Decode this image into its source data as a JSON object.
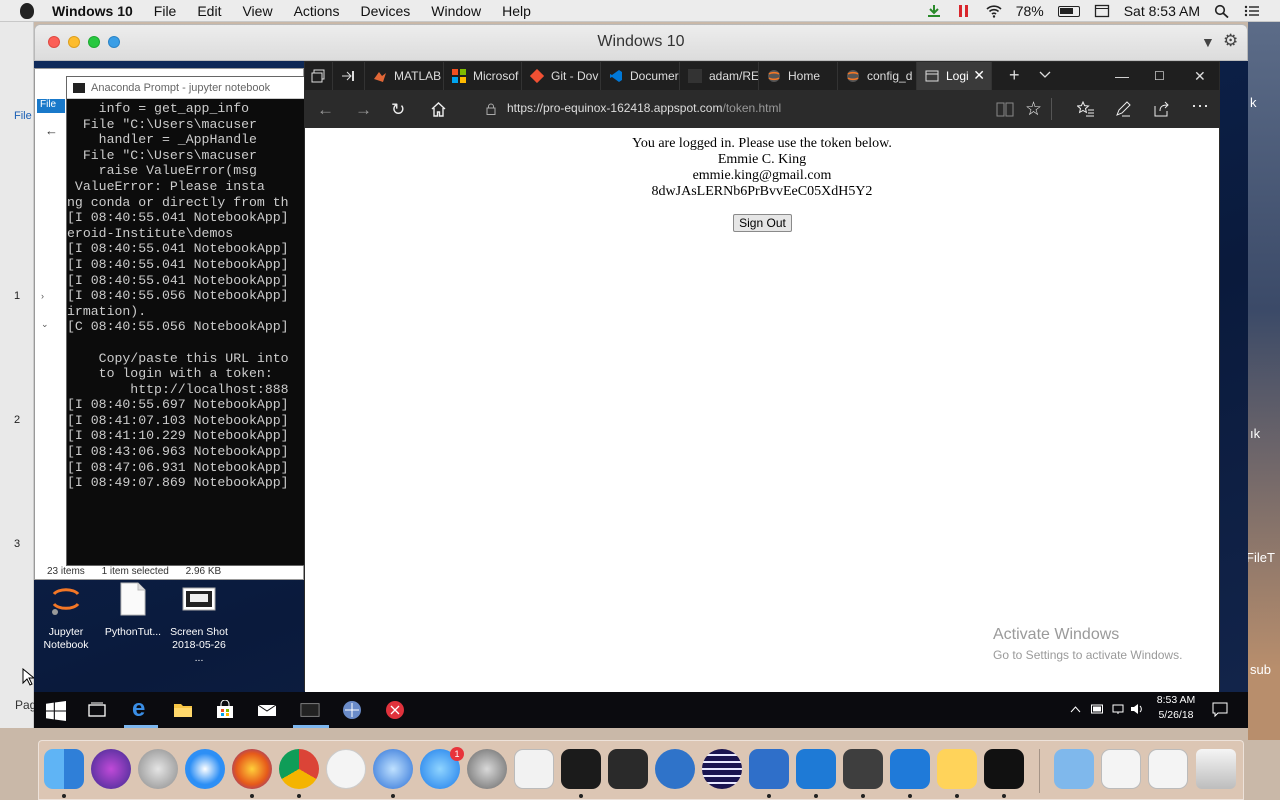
{
  "mac_menubar": {
    "app_name": "Windows 10",
    "menus": [
      "File",
      "Edit",
      "View",
      "Actions",
      "Devices",
      "Window",
      "Help"
    ],
    "battery": "78%",
    "clock": "Sat 8:53 AM"
  },
  "vm_window": {
    "title": "Windows 10"
  },
  "wallpaper_labels": [
    "k",
    "ık",
    "FileT",
    "sub"
  ],
  "ruler_numbers": [
    "1",
    "2",
    "3"
  ],
  "explorer": {
    "status_count": "23 items",
    "status_selected": "1 item selected",
    "status_size": "2.96 KB",
    "partial_menu": "File",
    "partial_footer": "Pag"
  },
  "anaconda": {
    "title": "Anaconda Prompt - jupyter  notebook",
    "lines": [
      "    info = get_app_info",
      "  File \"C:\\Users\\macuser",
      "    handler = _AppHandle",
      "  File \"C:\\Users\\macuser",
      "    raise ValueError(msg",
      " ValueError: Please insta",
      "ng conda or directly from th",
      "[I 08:40:55.041 NotebookApp]",
      "eroid-Institute\\demos",
      "[I 08:40:55.041 NotebookApp]",
      "[I 08:40:55.041 NotebookApp]",
      "[I 08:40:55.041 NotebookApp]",
      "[I 08:40:55.056 NotebookApp]",
      "irmation).",
      "[C 08:40:55.056 NotebookApp]",
      "",
      "    Copy/paste this URL into",
      "    to login with a token:",
      "        http://localhost:888",
      "[I 08:40:55.697 NotebookApp]",
      "[I 08:41:07.103 NotebookApp]",
      "[I 08:41:10.229 NotebookApp]",
      "[I 08:43:06.963 NotebookApp]",
      "[I 08:47:06.931 NotebookApp]",
      "[I 08:49:07.869 NotebookApp]"
    ]
  },
  "desktop_icons": [
    {
      "label": "Jupyter Notebook"
    },
    {
      "label": "PythonTut..."
    },
    {
      "label": "Screen Shot 2018-05-26 ..."
    }
  ],
  "edge": {
    "tabs": [
      {
        "label": "MATLAB",
        "color": "#e16737"
      },
      {
        "label": "Microsof",
        "color": "#f25022"
      },
      {
        "label": "Git - Dov",
        "color": "#f05033"
      },
      {
        "label": "Documer",
        "color": "#0078d7"
      },
      {
        "label": "adam/RE",
        "color": "#333333"
      },
      {
        "label": "Home",
        "color": "#f37726"
      },
      {
        "label": "config_d",
        "color": "#f37726"
      },
      {
        "label": "Logi",
        "color": "#dddddd"
      }
    ],
    "url_host": "https://pro-equinox-162418.appspot.com",
    "url_path": "/token.html"
  },
  "page": {
    "message": "You are logged in. Please use the token below.",
    "name": "Emmie C. King",
    "email": "emmie.king@gmail.com",
    "token": "8dwJAsLERNb6PrBvvEeC05XdH5Y2",
    "signout_label": "Sign Out"
  },
  "activate_windows": {
    "title": "Activate Windows",
    "subtitle": "Go to Settings to activate Windows."
  },
  "win_taskbar": {
    "time": "8:53 AM",
    "date": "5/26/18"
  }
}
